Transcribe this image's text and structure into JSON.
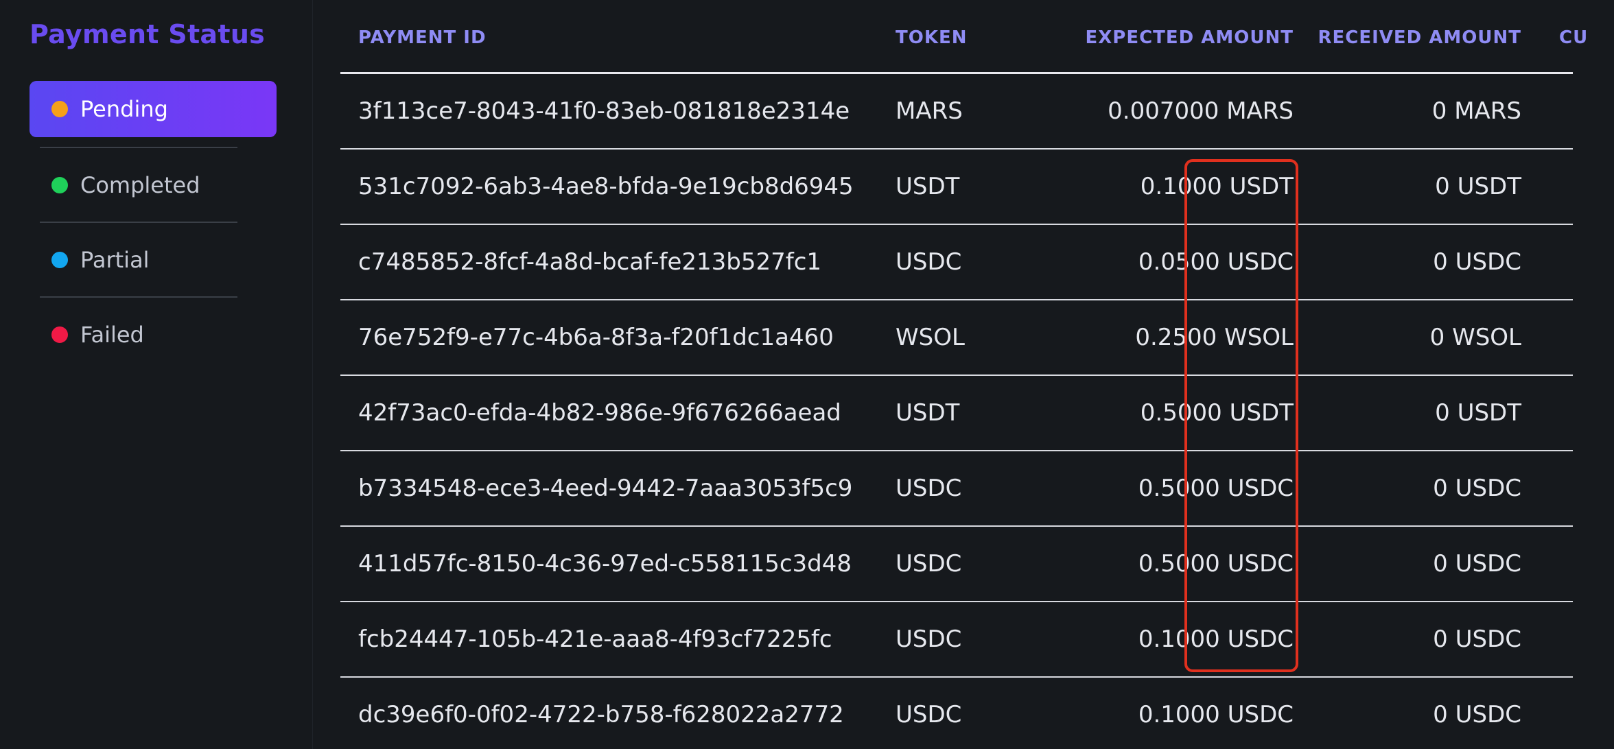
{
  "sidebar": {
    "title": "Payment Status",
    "items": [
      {
        "label": "Pending",
        "color": "#f5a01a",
        "active": true
      },
      {
        "label": "Completed",
        "color": "#1fd15a",
        "active": false
      },
      {
        "label": "Partial",
        "color": "#12a6f0",
        "active": false
      },
      {
        "label": "Failed",
        "color": "#f01a46",
        "active": false
      }
    ]
  },
  "table": {
    "columns": {
      "payment_id": "PAYMENT ID",
      "token": "TOKEN",
      "expected": "EXPECTED AMOUNT",
      "received": "RECEIVED AMOUNT",
      "extra": "CU"
    },
    "rows": [
      {
        "id": "3f113ce7-8043-41f0-83eb-081818e2314e",
        "token": "MARS",
        "expected": "0.007000 MARS",
        "received": "0 MARS"
      },
      {
        "id": "531c7092-6ab3-4ae8-bfda-9e19cb8d6945",
        "token": "USDT",
        "expected": "0.1000 USDT",
        "received": "0 USDT"
      },
      {
        "id": "c7485852-8fcf-4a8d-bcaf-fe213b527fc1",
        "token": "USDC",
        "expected": "0.0500 USDC",
        "received": "0 USDC"
      },
      {
        "id": "76e752f9-e77c-4b6a-8f3a-f20f1dc1a460",
        "token": "WSOL",
        "expected": "0.2500 WSOL",
        "received": "0 WSOL"
      },
      {
        "id": "42f73ac0-efda-4b82-986e-9f676266aead",
        "token": "USDT",
        "expected": "0.5000 USDT",
        "received": "0 USDT"
      },
      {
        "id": "b7334548-ece3-4eed-9442-7aaa3053f5c9",
        "token": "USDC",
        "expected": "0.5000 USDC",
        "received": "0 USDC"
      },
      {
        "id": "411d57fc-8150-4c36-97ed-c558115c3d48",
        "token": "USDC",
        "expected": "0.5000 USDC",
        "received": "0 USDC"
      },
      {
        "id": "fcb24447-105b-421e-aaa8-4f93cf7225fc",
        "token": "USDC",
        "expected": "0.1000 USDC",
        "received": "0 USDC"
      },
      {
        "id": "dc39e6f0-0f02-4722-b758-f628022a2772",
        "token": "USDC",
        "expected": "0.1000 USDC",
        "received": "0 USDC"
      }
    ]
  },
  "highlight_color": "#e0301e"
}
